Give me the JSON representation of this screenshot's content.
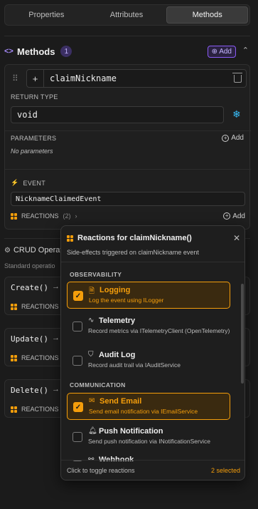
{
  "tabs": [
    {
      "label": "Properties"
    },
    {
      "label": "Attributes"
    },
    {
      "label": "Methods"
    }
  ],
  "methods": {
    "title": "Methods",
    "count": "1",
    "add_label": "Add",
    "method": {
      "name": "claimNickname",
      "return_type_label": "RETURN TYPE",
      "return_type": "void",
      "parameters_label": "PARAMETERS",
      "parameters_add": "Add",
      "no_params": "No parameters",
      "event_label": "EVENT",
      "event_value": "NicknameClaimedEvent",
      "reactions_label": "REACTIONS",
      "reactions_count": "(2)",
      "reactions_add": "Add"
    }
  },
  "crud": {
    "title": "CRUD Operat",
    "subtitle": "Standard operatio",
    "items": [
      {
        "name": "Create()",
        "reactions_label": "REACTIONS"
      },
      {
        "name": "Update()",
        "reactions_label": "REACTIONS"
      },
      {
        "name": "Delete()",
        "reactions_label": "REACTIONS"
      }
    ]
  },
  "popover": {
    "title": "Reactions for claimNickname()",
    "subtitle": "Side-effects triggered on claimNickname event",
    "sections": [
      {
        "label": "OBSERVABILITY"
      },
      {
        "label": "COMMUNICATION"
      }
    ],
    "items": [
      {
        "title": "Logging",
        "desc": "Log the event using ILogger",
        "checked": true,
        "icon": "document-icon"
      },
      {
        "title": "Telemetry",
        "desc": "Record metrics via ITelemetryClient (OpenTelemetry)",
        "checked": false,
        "icon": "pulse-icon"
      },
      {
        "title": "Audit Log",
        "desc": "Record audit trail via IAuditService",
        "checked": false,
        "icon": "shield-icon"
      },
      {
        "title": "Send Email",
        "desc": "Send email notification via IEmailService",
        "checked": true,
        "icon": "mail-icon"
      },
      {
        "title": "Push Notification",
        "desc": "Send push notification via INotificationService",
        "checked": false,
        "icon": "bell-icon"
      },
      {
        "title": "Webhook",
        "desc": "",
        "checked": false,
        "icon": "webhook-icon"
      }
    ],
    "footer_hint": "Click to toggle reactions",
    "footer_count": "2 selected"
  },
  "colors": {
    "accent": "#f59e0b",
    "purple": "#8b5cf6",
    "background": "#1b1b1b"
  }
}
